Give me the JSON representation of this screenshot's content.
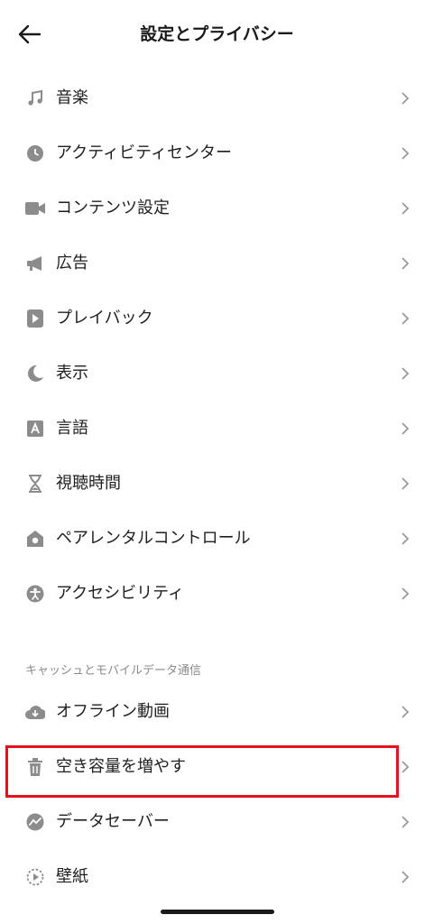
{
  "header": {
    "title": "設定とプライバシー"
  },
  "items_top": [
    {
      "label": "音楽",
      "icon": "music-note-icon"
    },
    {
      "label": "アクティビティセンター",
      "icon": "clock-icon"
    },
    {
      "label": "コンテンツ設定",
      "icon": "video-camera-icon"
    },
    {
      "label": "広告",
      "icon": "megaphone-icon"
    },
    {
      "label": "プレイバック",
      "icon": "play-icon"
    },
    {
      "label": "表示",
      "icon": "moon-icon"
    },
    {
      "label": "言語",
      "icon": "language-a-icon"
    },
    {
      "label": "視聴時間",
      "icon": "hourglass-icon"
    },
    {
      "label": "ペアレンタルコントロール",
      "icon": "home-shield-icon"
    },
    {
      "label": "アクセシビリティ",
      "icon": "accessibility-icon"
    }
  ],
  "section": {
    "title": "キャッシュとモバイルデータ通信"
  },
  "items_bottom": [
    {
      "label": "オフライン動画",
      "icon": "cloud-download-icon"
    },
    {
      "label": "空き容量を増やす",
      "icon": "trash-icon"
    },
    {
      "label": "データセーバー",
      "icon": "data-saver-icon"
    },
    {
      "label": "壁紙",
      "icon": "wallpaper-icon"
    }
  ],
  "colors": {
    "highlight": "#e3131d",
    "icon": "#8c8c8c",
    "chevron": "#9a9a9a"
  }
}
